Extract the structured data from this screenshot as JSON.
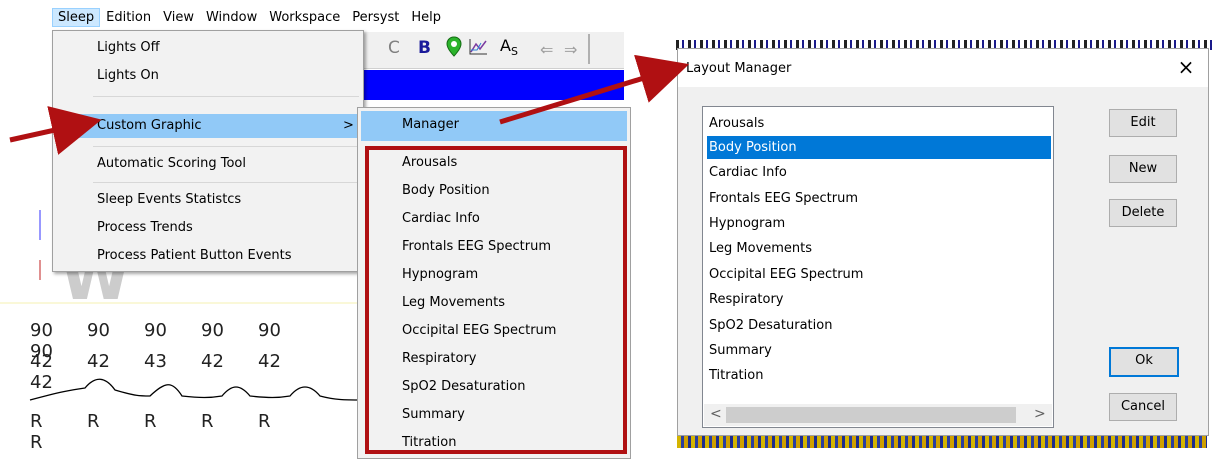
{
  "menubar": {
    "items": [
      "Sleep",
      "Edition",
      "View",
      "Window",
      "Workspace",
      "Persyst",
      "Help"
    ]
  },
  "toolbar": {
    "c_label": "C",
    "b_label": "B",
    "as_label": "As",
    "icons": [
      "pin-icon",
      "chart-icon",
      "text-icon",
      "back-arrow-icon",
      "forward-arrow-icon"
    ]
  },
  "sleep_menu": {
    "items": [
      "Lights Off",
      "Lights On",
      "Custom Graphic",
      "Automatic Scoring Tool",
      "Sleep Events Statistcs",
      "Process Trends",
      "Process Patient Button Events"
    ],
    "submenu_arrow": ">"
  },
  "submenu": {
    "manager": "Manager",
    "items": [
      "Arousals",
      "Body Position",
      "Cardiac Info",
      "Frontals EEG Spectrum",
      "Hypnogram",
      "Leg Movements",
      "Occipital EEG Spectrum",
      "Respiratory",
      "SpO2 Desaturation",
      "Summary",
      "Titration"
    ]
  },
  "background": {
    "big_letter": "W",
    "row1": [
      "90",
      "90",
      "90",
      "90",
      "90",
      "90"
    ],
    "row2": [
      "42",
      "42",
      "43",
      "42",
      "42",
      "42"
    ],
    "row3": [
      "R",
      "R",
      "R",
      "R",
      "R",
      "R"
    ]
  },
  "dialog": {
    "title": "Layout Manager",
    "close": "×",
    "list": [
      "Arousals",
      "Body Position",
      "Cardiac Info",
      "Frontals EEG Spectrum",
      "Hypnogram",
      "Leg Movements",
      "Occipital EEG Spectrum",
      "Respiratory",
      "SpO2 Desaturation",
      "Summary",
      "Titration"
    ],
    "selected": "Body Position",
    "buttons": {
      "edit": "Edit",
      "new": "New",
      "delete": "Delete",
      "ok": "Ok",
      "cancel": "Cancel"
    },
    "scroll_left": "<",
    "scroll_right": ">"
  },
  "colors": {
    "highlight": "#91c9f7",
    "selection": "#0078d7",
    "annotation_red": "#b01012",
    "blue_bar": "#0000ff"
  }
}
